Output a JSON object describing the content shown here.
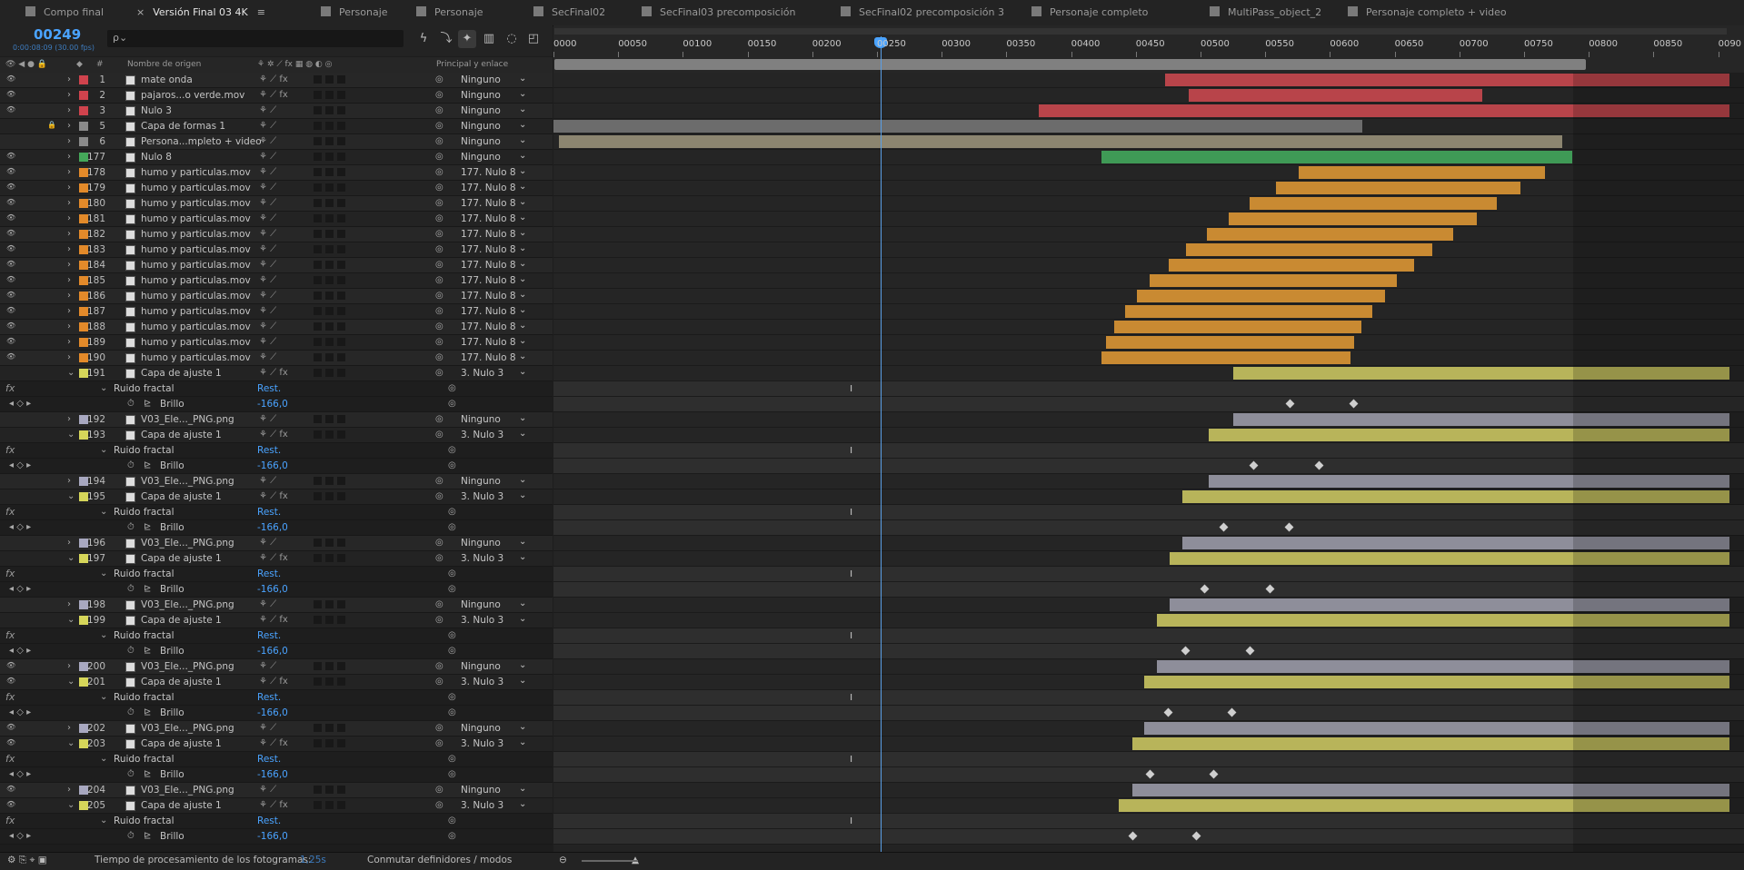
{
  "tabs": [
    {
      "label": "Compo final",
      "color": "#7a7a7a",
      "active": false
    },
    {
      "label": "Versión Final 03 4K",
      "color": "#7a7a7a",
      "active": true
    },
    {
      "label": "Personaje",
      "color": "#7a7a7a",
      "active": false
    },
    {
      "label": "Personaje",
      "color": "#7a7a7a",
      "active": false
    },
    {
      "label": "SecFinal02",
      "color": "#7a7a7a",
      "active": false
    },
    {
      "label": "SecFinal03 precomposición",
      "color": "#7a7a7a",
      "active": false
    },
    {
      "label": "SecFinal02 precomposición 3",
      "color": "#7a7a7a",
      "active": false
    },
    {
      "label": "Personaje completo",
      "color": "#7a7a7a",
      "active": false
    },
    {
      "label": "MultiPass_object_2",
      "color": "#7a7a7a",
      "active": false
    },
    {
      "label": "Personaje completo + video",
      "color": "#7a7a7a",
      "active": false
    }
  ],
  "timecode": "00249",
  "fps": "0:00:08:09 (30.00 fps)",
  "search": {
    "placeholder": "ρ⌄"
  },
  "columns": {
    "name": "Nombre de origen",
    "num": "#",
    "parent": "Principal y enlace"
  },
  "ruler": {
    "ticks": [
      "0000",
      "00050",
      "00100",
      "00150",
      "00200",
      "00250",
      "00300",
      "00350",
      "00400",
      "00450",
      "00500",
      "00550",
      "00600",
      "00650",
      "00700",
      "00750",
      "00800",
      "00850",
      "0090"
    ]
  },
  "accent": "#4aa3ff",
  "layers": [
    {
      "kind": "layer",
      "eye": true,
      "lock": false,
      "color": "#d0434d",
      "num": "1",
      "name": "mate onda",
      "fx": true,
      "parent": "Ninguno",
      "bar": {
        "start": 0.52,
        "end": 1.0,
        "color": "#b8444a"
      }
    },
    {
      "kind": "layer",
      "eye": true,
      "lock": false,
      "color": "#d0434d",
      "num": "2",
      "name": "pajaros...o verde.mov",
      "fx": true,
      "parent": "Ninguno",
      "bar": {
        "start": 0.54,
        "end": 0.79,
        "color": "#b8444a"
      }
    },
    {
      "kind": "layer",
      "eye": true,
      "lock": false,
      "color": "#d0434d",
      "num": "3",
      "name": "Nulo 3",
      "fx": false,
      "parent": "Ninguno",
      "bar": {
        "start": 0.413,
        "end": 1.0,
        "color": "#b8444a"
      }
    },
    {
      "kind": "layer",
      "eye": false,
      "lock": true,
      "color": "#8a8a8a",
      "num": "5",
      "name": "Capa de formas 1",
      "fx": false,
      "parent": "Ninguno",
      "bar": {
        "start": 0.0,
        "end": 0.688,
        "color": "#6c6c6c"
      }
    },
    {
      "kind": "layer",
      "eye": false,
      "lock": false,
      "color": "#8a8a8a",
      "num": "6",
      "name": "Persona...mpleto + video",
      "fx": false,
      "parent": "Ninguno",
      "bar": {
        "start": 0.005,
        "end": 0.858,
        "color": "#8c8570"
      }
    },
    {
      "kind": "layer",
      "eye": true,
      "lock": false,
      "color": "#45a85a",
      "num": "177",
      "name": "Nulo 8",
      "fx": false,
      "parent": "Ninguno",
      "bar": {
        "start": 0.466,
        "end": 0.866,
        "color": "#3f9a56"
      }
    },
    {
      "kind": "layer",
      "eye": true,
      "lock": false,
      "color": "#e38a2a",
      "num": "178",
      "name": "humo y particulas.mov",
      "fx": false,
      "parent": "177. Nulo 8",
      "bar": {
        "start": 0.634,
        "end": 0.843,
        "color": "#c98a32"
      }
    },
    {
      "kind": "layer",
      "eye": true,
      "lock": false,
      "color": "#e38a2a",
      "num": "179",
      "name": "humo y particulas.mov",
      "fx": false,
      "parent": "177. Nulo 8",
      "bar": {
        "start": 0.614,
        "end": 0.822,
        "color": "#c98a32"
      }
    },
    {
      "kind": "layer",
      "eye": true,
      "lock": false,
      "color": "#e38a2a",
      "num": "180",
      "name": "humo y particulas.mov",
      "fx": false,
      "parent": "177. Nulo 8",
      "bar": {
        "start": 0.592,
        "end": 0.802,
        "color": "#c98a32"
      }
    },
    {
      "kind": "layer",
      "eye": true,
      "lock": false,
      "color": "#e38a2a",
      "num": "181",
      "name": "humo y particulas.mov",
      "fx": false,
      "parent": "177. Nulo 8",
      "bar": {
        "start": 0.574,
        "end": 0.785,
        "color": "#c98a32"
      }
    },
    {
      "kind": "layer",
      "eye": true,
      "lock": false,
      "color": "#e38a2a",
      "num": "182",
      "name": "humo y particulas.mov",
      "fx": false,
      "parent": "177. Nulo 8",
      "bar": {
        "start": 0.556,
        "end": 0.765,
        "color": "#c98a32"
      }
    },
    {
      "kind": "layer",
      "eye": true,
      "lock": false,
      "color": "#e38a2a",
      "num": "183",
      "name": "humo y particulas.mov",
      "fx": false,
      "parent": "177. Nulo 8",
      "bar": {
        "start": 0.538,
        "end": 0.747,
        "color": "#c98a32"
      }
    },
    {
      "kind": "layer",
      "eye": true,
      "lock": false,
      "color": "#e38a2a",
      "num": "184",
      "name": "humo y particulas.mov",
      "fx": false,
      "parent": "177. Nulo 8",
      "bar": {
        "start": 0.523,
        "end": 0.732,
        "color": "#c98a32"
      }
    },
    {
      "kind": "layer",
      "eye": true,
      "lock": false,
      "color": "#e38a2a",
      "num": "185",
      "name": "humo y particulas.mov",
      "fx": false,
      "parent": "177. Nulo 8",
      "bar": {
        "start": 0.507,
        "end": 0.717,
        "color": "#c98a32"
      }
    },
    {
      "kind": "layer",
      "eye": true,
      "lock": false,
      "color": "#e38a2a",
      "num": "186",
      "name": "humo y particulas.mov",
      "fx": false,
      "parent": "177. Nulo 8",
      "bar": {
        "start": 0.496,
        "end": 0.707,
        "color": "#c98a32"
      }
    },
    {
      "kind": "layer",
      "eye": true,
      "lock": false,
      "color": "#e38a2a",
      "num": "187",
      "name": "humo y particulas.mov",
      "fx": false,
      "parent": "177. Nulo 8",
      "bar": {
        "start": 0.486,
        "end": 0.696,
        "color": "#c98a32"
      }
    },
    {
      "kind": "layer",
      "eye": true,
      "lock": false,
      "color": "#e38a2a",
      "num": "188",
      "name": "humo y particulas.mov",
      "fx": false,
      "parent": "177. Nulo 8",
      "bar": {
        "start": 0.477,
        "end": 0.687,
        "color": "#c98a32"
      }
    },
    {
      "kind": "layer",
      "eye": true,
      "lock": false,
      "color": "#e38a2a",
      "num": "189",
      "name": "humo y particulas.mov",
      "fx": false,
      "parent": "177. Nulo 8",
      "bar": {
        "start": 0.47,
        "end": 0.681,
        "color": "#c98a32"
      }
    },
    {
      "kind": "layer",
      "eye": true,
      "lock": false,
      "color": "#e38a2a",
      "num": "190",
      "name": "humo y particulas.mov",
      "fx": false,
      "parent": "177. Nulo 8",
      "bar": {
        "start": 0.466,
        "end": 0.678,
        "color": "#c98a32"
      }
    },
    {
      "kind": "layer",
      "eye": false,
      "lock": false,
      "open": true,
      "color": "#d6d65a",
      "num": "191",
      "name": "Capa de ajuste 1",
      "fx": true,
      "parent": "3. Nulo 3",
      "bar": {
        "start": 0.578,
        "end": 1.0,
        "color": "#b8b45a"
      }
    },
    {
      "kind": "effect",
      "name": "Ruido fractal",
      "rest": "Rest.",
      "kf": 0.252
    },
    {
      "kind": "prop",
      "name": "Brillo",
      "value": "-166,0",
      "keys": [
        0.624,
        0.678
      ]
    },
    {
      "kind": "layer",
      "eye": false,
      "lock": false,
      "color": "#a8a8c0",
      "num": "192",
      "name": "V03_Ele..._PNG.png",
      "fx": false,
      "parent": "Ninguno",
      "bar": {
        "start": 0.578,
        "end": 1.0,
        "color": "#8e8e9a"
      }
    },
    {
      "kind": "layer",
      "eye": false,
      "lock": false,
      "open": true,
      "color": "#d6d65a",
      "num": "193",
      "name": "Capa de ajuste 1",
      "fx": true,
      "parent": "3. Nulo 3",
      "bar": {
        "start": 0.557,
        "end": 1.0,
        "color": "#b8b45a"
      }
    },
    {
      "kind": "effect",
      "name": "Ruido fractal",
      "rest": "Rest.",
      "kf": 0.252
    },
    {
      "kind": "prop",
      "name": "Brillo",
      "value": "-166,0",
      "keys": [
        0.593,
        0.648
      ]
    },
    {
      "kind": "layer",
      "eye": false,
      "lock": false,
      "color": "#a8a8c0",
      "num": "194",
      "name": "V03_Ele..._PNG.png",
      "fx": false,
      "parent": "Ninguno",
      "bar": {
        "start": 0.557,
        "end": 1.0,
        "color": "#8e8e9a"
      }
    },
    {
      "kind": "layer",
      "eye": false,
      "lock": false,
      "open": true,
      "color": "#d6d65a",
      "num": "195",
      "name": "Capa de ajuste 1",
      "fx": true,
      "parent": "3. Nulo 3",
      "bar": {
        "start": 0.535,
        "end": 1.0,
        "color": "#b8b45a"
      }
    },
    {
      "kind": "effect",
      "name": "Ruido fractal",
      "rest": "Rest.",
      "kf": 0.252
    },
    {
      "kind": "prop",
      "name": "Brillo",
      "value": "-166,0",
      "keys": [
        0.567,
        0.623
      ]
    },
    {
      "kind": "layer",
      "eye": false,
      "lock": false,
      "color": "#a8a8c0",
      "num": "196",
      "name": "V03_Ele..._PNG.png",
      "fx": false,
      "parent": "Ninguno",
      "bar": {
        "start": 0.535,
        "end": 1.0,
        "color": "#8e8e9a"
      }
    },
    {
      "kind": "layer",
      "eye": false,
      "lock": false,
      "open": true,
      "color": "#d6d65a",
      "num": "197",
      "name": "Capa de ajuste 1",
      "fx": true,
      "parent": "3. Nulo 3",
      "bar": {
        "start": 0.524,
        "end": 1.0,
        "color": "#b8b45a"
      }
    },
    {
      "kind": "effect",
      "name": "Ruido fractal",
      "rest": "Rest.",
      "kf": 0.252
    },
    {
      "kind": "prop",
      "name": "Brillo",
      "value": "-166,0",
      "keys": [
        0.551,
        0.607
      ]
    },
    {
      "kind": "layer",
      "eye": false,
      "lock": false,
      "color": "#a8a8c0",
      "num": "198",
      "name": "V03_Ele..._PNG.png",
      "fx": false,
      "parent": "Ninguno",
      "bar": {
        "start": 0.524,
        "end": 1.0,
        "color": "#8e8e9a"
      }
    },
    {
      "kind": "layer",
      "eye": false,
      "lock": false,
      "open": true,
      "color": "#d6d65a",
      "num": "199",
      "name": "Capa de ajuste 1",
      "fx": true,
      "parent": "3. Nulo 3",
      "bar": {
        "start": 0.513,
        "end": 1.0,
        "color": "#b8b45a"
      }
    },
    {
      "kind": "effect",
      "name": "Ruido fractal",
      "rest": "Rest.",
      "kf": 0.252
    },
    {
      "kind": "prop",
      "name": "Brillo",
      "value": "-166,0",
      "keys": [
        0.535,
        0.59
      ]
    },
    {
      "kind": "layer",
      "eye": true,
      "lock": false,
      "color": "#a8a8c0",
      "num": "200",
      "name": "V03_Ele..._PNG.png",
      "fx": false,
      "parent": "Ninguno",
      "bar": {
        "start": 0.513,
        "end": 1.0,
        "color": "#8e8e9a"
      }
    },
    {
      "kind": "layer",
      "eye": true,
      "lock": false,
      "open": true,
      "color": "#d6d65a",
      "num": "201",
      "name": "Capa de ajuste 1",
      "fx": true,
      "parent": "3. Nulo 3",
      "bar": {
        "start": 0.502,
        "end": 1.0,
        "color": "#b8b45a"
      }
    },
    {
      "kind": "effect",
      "name": "Ruido fractal",
      "rest": "Rest.",
      "kf": 0.252
    },
    {
      "kind": "prop",
      "name": "Brillo",
      "value": "-166,0",
      "keys": [
        0.52,
        0.574
      ]
    },
    {
      "kind": "layer",
      "eye": true,
      "lock": false,
      "color": "#a8a8c0",
      "num": "202",
      "name": "V03_Ele..._PNG.png",
      "fx": false,
      "parent": "Ninguno",
      "bar": {
        "start": 0.502,
        "end": 1.0,
        "color": "#8e8e9a"
      }
    },
    {
      "kind": "layer",
      "eye": true,
      "lock": false,
      "open": true,
      "color": "#d6d65a",
      "num": "203",
      "name": "Capa de ajuste 1",
      "fx": true,
      "parent": "3. Nulo 3",
      "bar": {
        "start": 0.492,
        "end": 1.0,
        "color": "#b8b45a"
      }
    },
    {
      "kind": "effect",
      "name": "Ruido fractal",
      "rest": "Rest.",
      "kf": 0.252
    },
    {
      "kind": "prop",
      "name": "Brillo",
      "value": "-166,0",
      "keys": [
        0.505,
        0.559
      ]
    },
    {
      "kind": "layer",
      "eye": true,
      "lock": false,
      "color": "#a8a8c0",
      "num": "204",
      "name": "V03_Ele..._PNG.png",
      "fx": false,
      "parent": "Ninguno",
      "bar": {
        "start": 0.492,
        "end": 1.0,
        "color": "#8e8e9a"
      }
    },
    {
      "kind": "layer",
      "eye": true,
      "lock": false,
      "open": true,
      "color": "#d6d65a",
      "num": "205",
      "name": "Capa de ajuste 1",
      "fx": true,
      "parent": "3. Nulo 3",
      "bar": {
        "start": 0.481,
        "end": 1.0,
        "color": "#b8b45a"
      }
    },
    {
      "kind": "effect",
      "name": "Ruido fractal",
      "rest": "Rest.",
      "kf": 0.252
    },
    {
      "kind": "prop",
      "name": "Brillo",
      "value": "-166,0",
      "keys": [
        0.49,
        0.544
      ]
    }
  ],
  "status": {
    "render_label": "Tiempo de procesamiento de los fotogramas:",
    "render_value": "1,25s",
    "toggle": "Conmutar definidores / modos"
  }
}
